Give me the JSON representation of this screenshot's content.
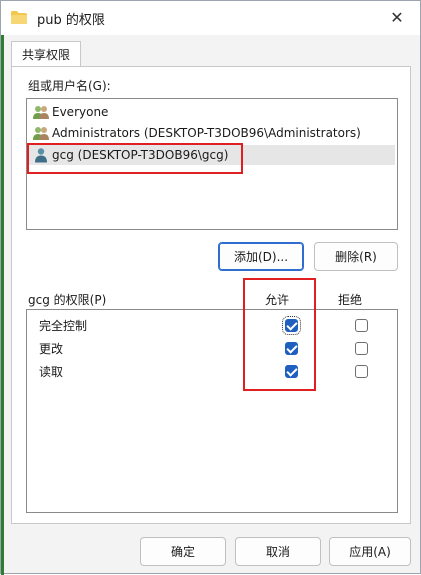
{
  "window": {
    "title": "pub 的权限",
    "close_glyph": "✕"
  },
  "tabs": [
    {
      "label": "共享权限"
    }
  ],
  "groups": {
    "label": "组或用户名(G):",
    "users": [
      {
        "name": "Everyone",
        "icon": "group-users-icon"
      },
      {
        "name": "Administrators (DESKTOP-T3DOB96\\Administrators)",
        "icon": "group-users-icon"
      },
      {
        "name": "gcg (DESKTOP-T3DOB96\\gcg)",
        "icon": "single-user-icon",
        "selected": true
      }
    ]
  },
  "buttons": {
    "add": "添加(D)...",
    "remove": "删除(R)",
    "ok": "确定",
    "cancel": "取消",
    "apply": "应用(A)"
  },
  "permissions": {
    "label": "gcg 的权限(P)",
    "allow_header": "允许",
    "deny_header": "拒绝",
    "rows": [
      {
        "name": "完全控制",
        "allow": true,
        "deny": false
      },
      {
        "name": "更改",
        "allow": true,
        "deny": false
      },
      {
        "name": "读取",
        "allow": true,
        "deny": false
      }
    ]
  },
  "colors": {
    "accent": "#1f5fbf",
    "highlight": "#e02020"
  }
}
